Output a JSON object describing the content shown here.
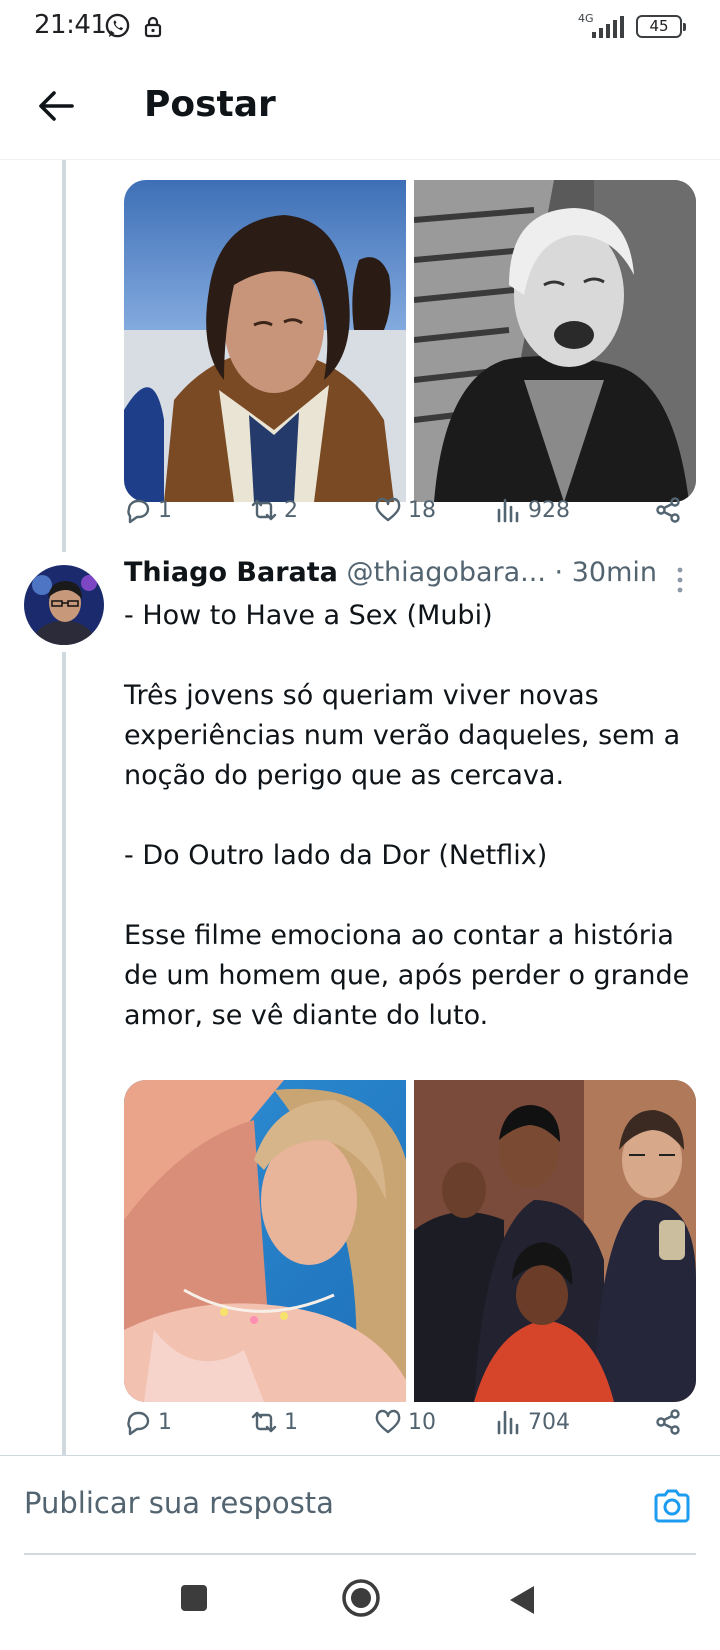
{
  "status_bar": {
    "time": "21:41",
    "network": "4G",
    "battery": "45"
  },
  "header": {
    "title": "Postar"
  },
  "tweets": [
    {
      "media": [
        {
          "alt": "man with long hair in brown jacket"
        },
        {
          "alt": "smiling woman in black and white photo"
        }
      ],
      "actions": {
        "replies": "1",
        "retweets": "2",
        "likes": "18",
        "views": "928"
      }
    },
    {
      "author_name": "Thiago Barata",
      "author_handle": "@thiagobara...",
      "separator": "·",
      "time": "30min",
      "lines": [
        "- How to Have a Sex (Mubi)",
        "",
        "Três jovens só queriam viver novas",
        "experiências num verão daqueles, sem a",
        "noção do perigo que as cercava.",
        "",
        "- Do Outro lado da Dor (Netflix)",
        "",
        "Esse filme emociona ao contar a história",
        "de um homem que, após perder o grande",
        "amor, se vê diante do luto."
      ],
      "media": [
        {
          "alt": "blonde woman at a pool"
        },
        {
          "alt": "group of friends laughing on a couch"
        }
      ],
      "actions": {
        "replies": "1",
        "retweets": "1",
        "likes": "10",
        "views": "704"
      }
    }
  ],
  "reply": {
    "placeholder": "Publicar sua resposta"
  },
  "colors": {
    "accent": "#1d9bf0",
    "text": "#0f1419",
    "muted": "#536471",
    "thread_line": "#cfd9de"
  }
}
